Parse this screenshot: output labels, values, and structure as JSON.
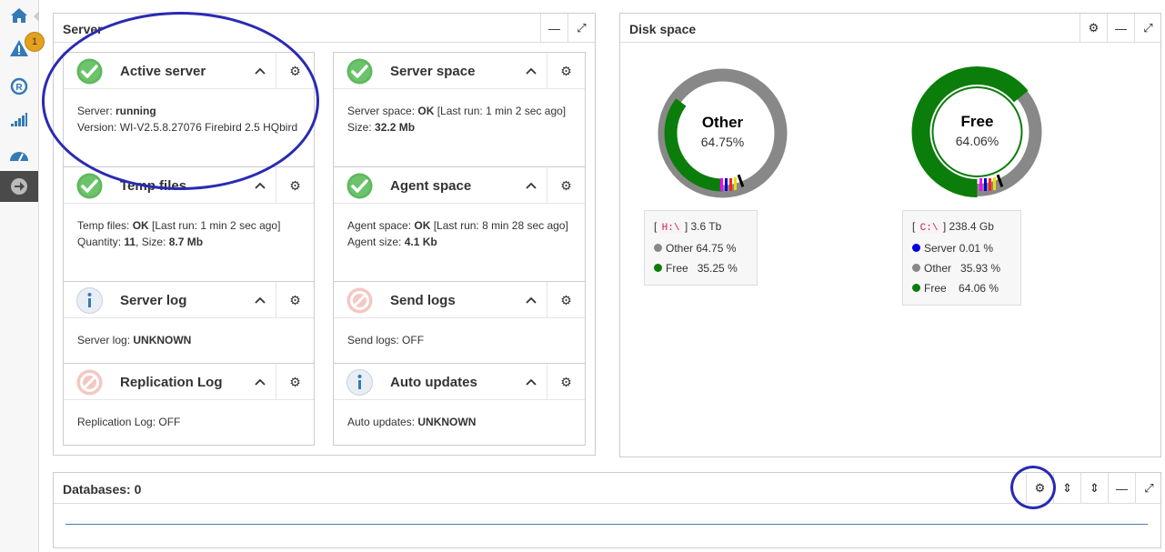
{
  "sidebar": {
    "items": [
      {
        "name": "home",
        "active": true
      },
      {
        "name": "alerts",
        "badge": "1"
      },
      {
        "name": "replication"
      },
      {
        "name": "stats"
      },
      {
        "name": "dashboard"
      },
      {
        "name": "next"
      }
    ]
  },
  "server_panel": {
    "title": "Server",
    "cards": [
      {
        "title": "Active server",
        "status": "ok",
        "lines": [
          [
            "Server: ",
            "running",
            ""
          ],
          [
            "Version: WI-V2.5.8.27076 Firebird 2.5 HQbird",
            "",
            ""
          ]
        ]
      },
      {
        "title": "Server space",
        "status": "ok",
        "lines": [
          [
            "Server space: ",
            "OK",
            " [Last run: 1 min 2 sec ago]"
          ],
          [
            "Size: ",
            "32.2 Mb",
            ""
          ]
        ]
      },
      {
        "title": "Temp files",
        "status": "ok",
        "lines": [
          [
            "Temp files: ",
            "OK",
            " [Last run: 1 min 2 sec ago]"
          ],
          [
            "Quantity: ",
            "11",
            ", Size: "
          ],
          [
            "",
            "8.7 Mb",
            ""
          ]
        ]
      },
      {
        "title": "Agent space",
        "status": "ok",
        "lines": [
          [
            "Agent space: ",
            "OK",
            " [Last run: 8 min 28 sec ago]"
          ],
          [
            "Agent size: ",
            "4.1 Kb",
            ""
          ]
        ]
      },
      {
        "title": "Server log",
        "status": "info",
        "lines": [
          [
            "Server log: ",
            "UNKNOWN",
            ""
          ]
        ]
      },
      {
        "title": "Send logs",
        "status": "off",
        "lines": [
          [
            "Send logs: OFF",
            "",
            ""
          ]
        ]
      },
      {
        "title": "Replication Log",
        "status": "off",
        "lines": [
          [
            "Replication Log: OFF",
            "",
            ""
          ]
        ]
      },
      {
        "title": "Auto updates",
        "status": "info",
        "lines": [
          [
            "Auto updates: ",
            "UNKNOWN",
            ""
          ]
        ]
      }
    ]
  },
  "disk_panel": {
    "title": "Disk space",
    "drives": [
      {
        "label": "Other",
        "percent": "64.75%",
        "drive": "H:\\",
        "size": "3.6 Tb",
        "legend": [
          {
            "name": "Other",
            "value": "64.75 %",
            "color": "#888888"
          },
          {
            "name": "Free",
            "value": "35.25 %",
            "color": "#0a7d0a"
          }
        ]
      },
      {
        "label": "Free",
        "percent": "64.06%",
        "drive": "C:\\",
        "size": "238.4 Gb",
        "legend": [
          {
            "name": "Server",
            "value": "0.01 %",
            "color": "#0000dd"
          },
          {
            "name": "Other",
            "value": "35.93 %",
            "color": "#888888"
          },
          {
            "name": "Free",
            "value": "64.06 %",
            "color": "#0a7d0a"
          }
        ]
      }
    ]
  },
  "databases_panel": {
    "title": "Databases: 0"
  },
  "colors": {
    "ok": "#5cb85c",
    "free": "#0a7d0a",
    "other": "#888888",
    "server": "#0000dd",
    "annotation": "#2a2ab3",
    "sidebar_active": "#337ab7"
  }
}
